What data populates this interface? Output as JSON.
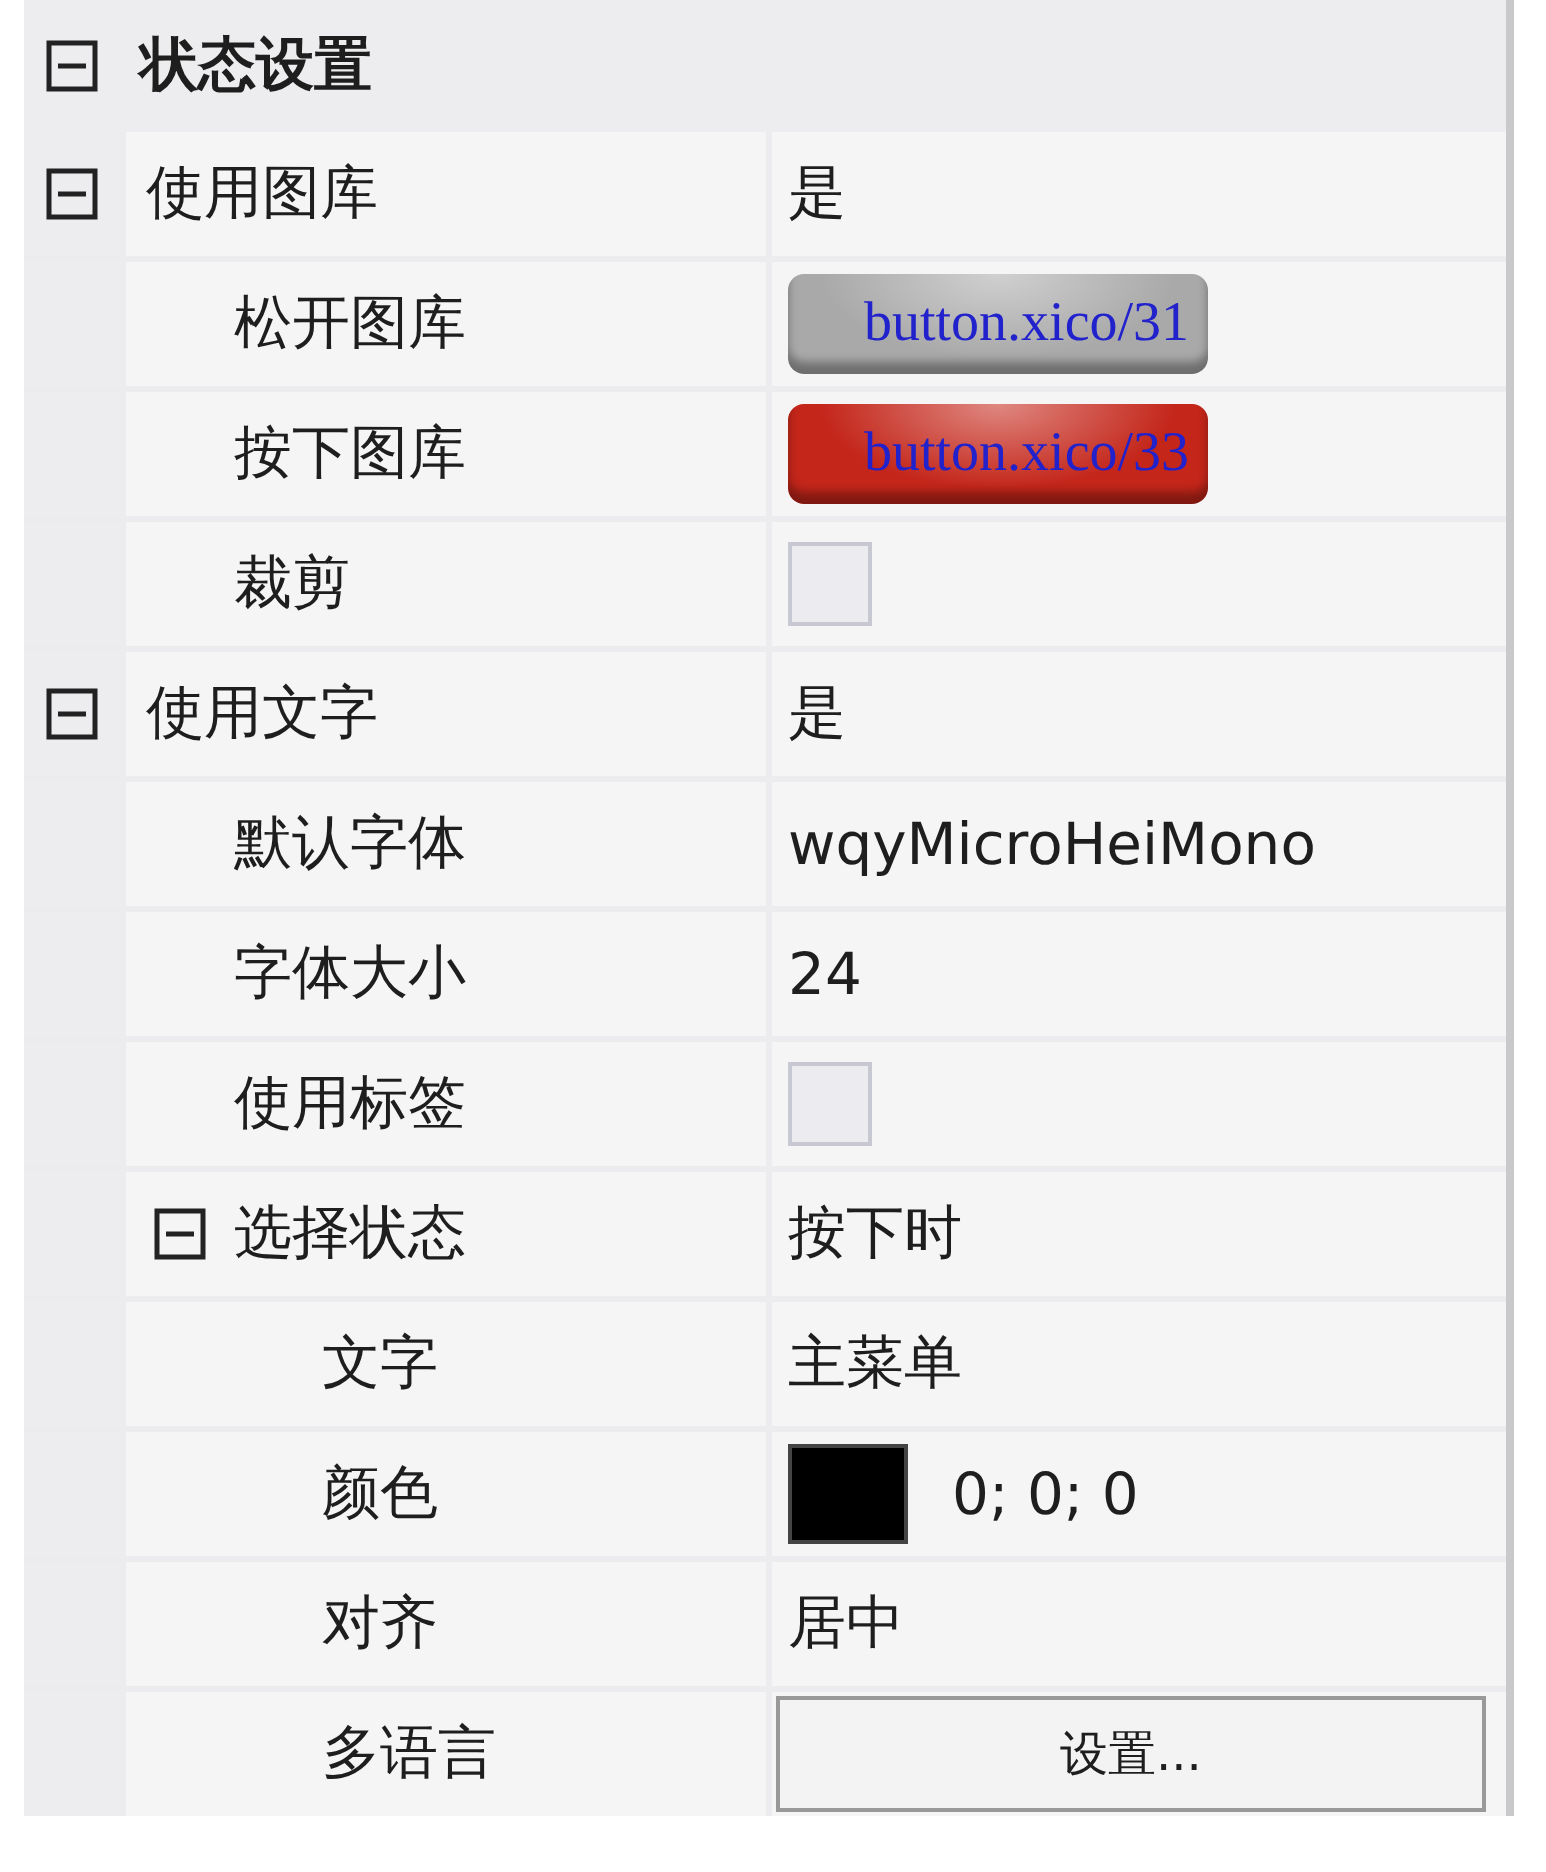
{
  "section": {
    "label": "状态设置",
    "expanded": true,
    "children": [
      {
        "label": "使用图库",
        "kind": "text",
        "value": "是",
        "expanded": true,
        "children": [
          {
            "label": "松开图库",
            "kind": "image",
            "value": "button.xico/31",
            "color": "#a9a9a9"
          },
          {
            "label": "按下图库",
            "kind": "image",
            "value": "button.xico/33",
            "color": "#c4261a"
          },
          {
            "label": "裁剪",
            "kind": "checkbox",
            "checked": false
          }
        ]
      },
      {
        "label": "使用文字",
        "kind": "text",
        "value": "是",
        "expanded": true,
        "children": [
          {
            "label": "默认字体",
            "kind": "text",
            "value": "wqyMicroHeiMono"
          },
          {
            "label": "字体大小",
            "kind": "text",
            "value": "24"
          },
          {
            "label": "使用标签",
            "kind": "checkbox",
            "checked": false
          },
          {
            "label": "选择状态",
            "kind": "text",
            "value": "按下时",
            "expanded": true,
            "children": [
              {
                "label": "文字",
                "kind": "text",
                "value": "主菜单"
              },
              {
                "label": "颜色",
                "kind": "color",
                "color": "#000000",
                "value": "0; 0; 0"
              },
              {
                "label": "对齐",
                "kind": "text",
                "value": "居中"
              },
              {
                "label": "多语言",
                "kind": "button",
                "value": "设置..."
              }
            ]
          }
        ]
      }
    ]
  }
}
